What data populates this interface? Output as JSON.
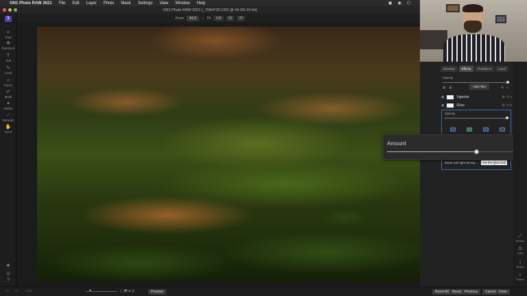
{
  "menubar": {
    "apple": "",
    "app_name": "ON1 Photo RAW 2021",
    "menus": [
      "File",
      "Edit",
      "Layer",
      "Photo",
      "Mask",
      "Settings",
      "View",
      "Window",
      "Help"
    ]
  },
  "window": {
    "title": "ON1 Photo RAW 2021 (_70A4725.CR2 @ 44.3% 16-bit)"
  },
  "zoom": {
    "label": "Zoom",
    "value": "44.3",
    "fit": "Fit",
    "presets": [
      "100",
      "50",
      "25"
    ]
  },
  "left_tools": [
    {
      "icon": "crop-icon",
      "label": "Crop"
    },
    {
      "icon": "transform-icon",
      "label": "Transform"
    },
    {
      "icon": "text-icon",
      "label": "Text"
    },
    {
      "icon": "local-brush-icon",
      "label": "Local"
    },
    {
      "icon": "faces-icon",
      "label": "Faces"
    },
    {
      "icon": "mask-icon",
      "label": "Mask"
    },
    {
      "icon": "refine-icon",
      "label": "Refine"
    },
    {
      "icon": "retouch-icon",
      "label": "Retouch"
    },
    {
      "icon": "hand-icon",
      "label": "Hand"
    }
  ],
  "side_tabs": [
    "Develop",
    "Effects",
    "Portrait AI",
    "Local"
  ],
  "active_tab": "Effects",
  "panel": {
    "opacity_label": "Opacity",
    "add_filter": "Add Filter",
    "filters": [
      {
        "name": "Vignette"
      },
      {
        "name": "Glow"
      }
    ],
    "glow_opacity_label": "Opacity",
    "mode_label": "Mode",
    "mode_value": "Soft light Strong",
    "tooltip": "Set the glow look"
  },
  "amount_popup": {
    "label": "Amount",
    "value": "67",
    "fraction": 0.67
  },
  "right_tools": [
    {
      "icon": "resize-icon",
      "label": "Resize"
    },
    {
      "icon": "print-icon",
      "label": "Print"
    },
    {
      "icon": "share-icon",
      "label": "Share"
    },
    {
      "icon": "export-icon",
      "label": "Export"
    }
  ],
  "bottom": {
    "preview": "Preview",
    "buttons": [
      "Reset All",
      "Reset",
      "Previous",
      "Cancel",
      "Done"
    ]
  },
  "colors": {
    "accent": "#4a8fe6",
    "logo": "#5b3fb8",
    "panel_bg": "#222222"
  }
}
